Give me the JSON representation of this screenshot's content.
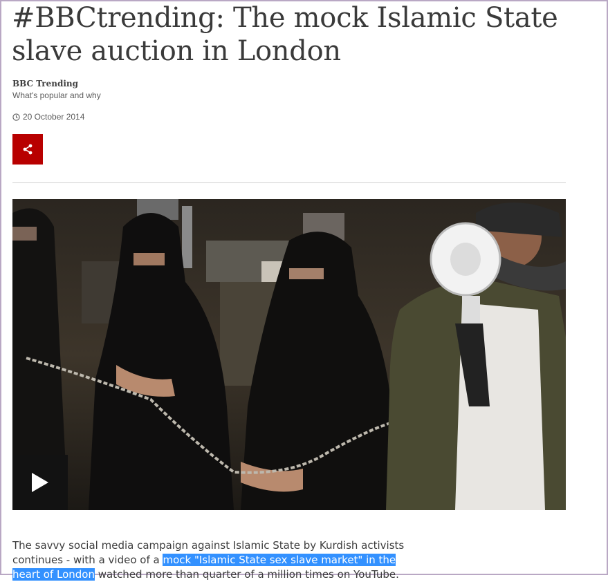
{
  "article": {
    "headline": "#BBCtrending: The mock Islamic State slave auction in London",
    "author_name": "BBC Trending",
    "author_desc": "What's popular and why",
    "date": "20 October 2014",
    "summary_before": "The savvy social media campaign against Islamic State by Kurdish activists continues - with a video of a ",
    "summary_link": "mock \"Islamic State sex slave market\" in the heart of London",
    "summary_after": " watched more than quarter of a million times on YouTube."
  },
  "icons": {
    "clock": "clock-icon",
    "share": "share-icon",
    "play": "play-icon"
  },
  "colors": {
    "share_bg": "#b80000",
    "highlight": "#3391ff",
    "play_bg": "#121212"
  }
}
